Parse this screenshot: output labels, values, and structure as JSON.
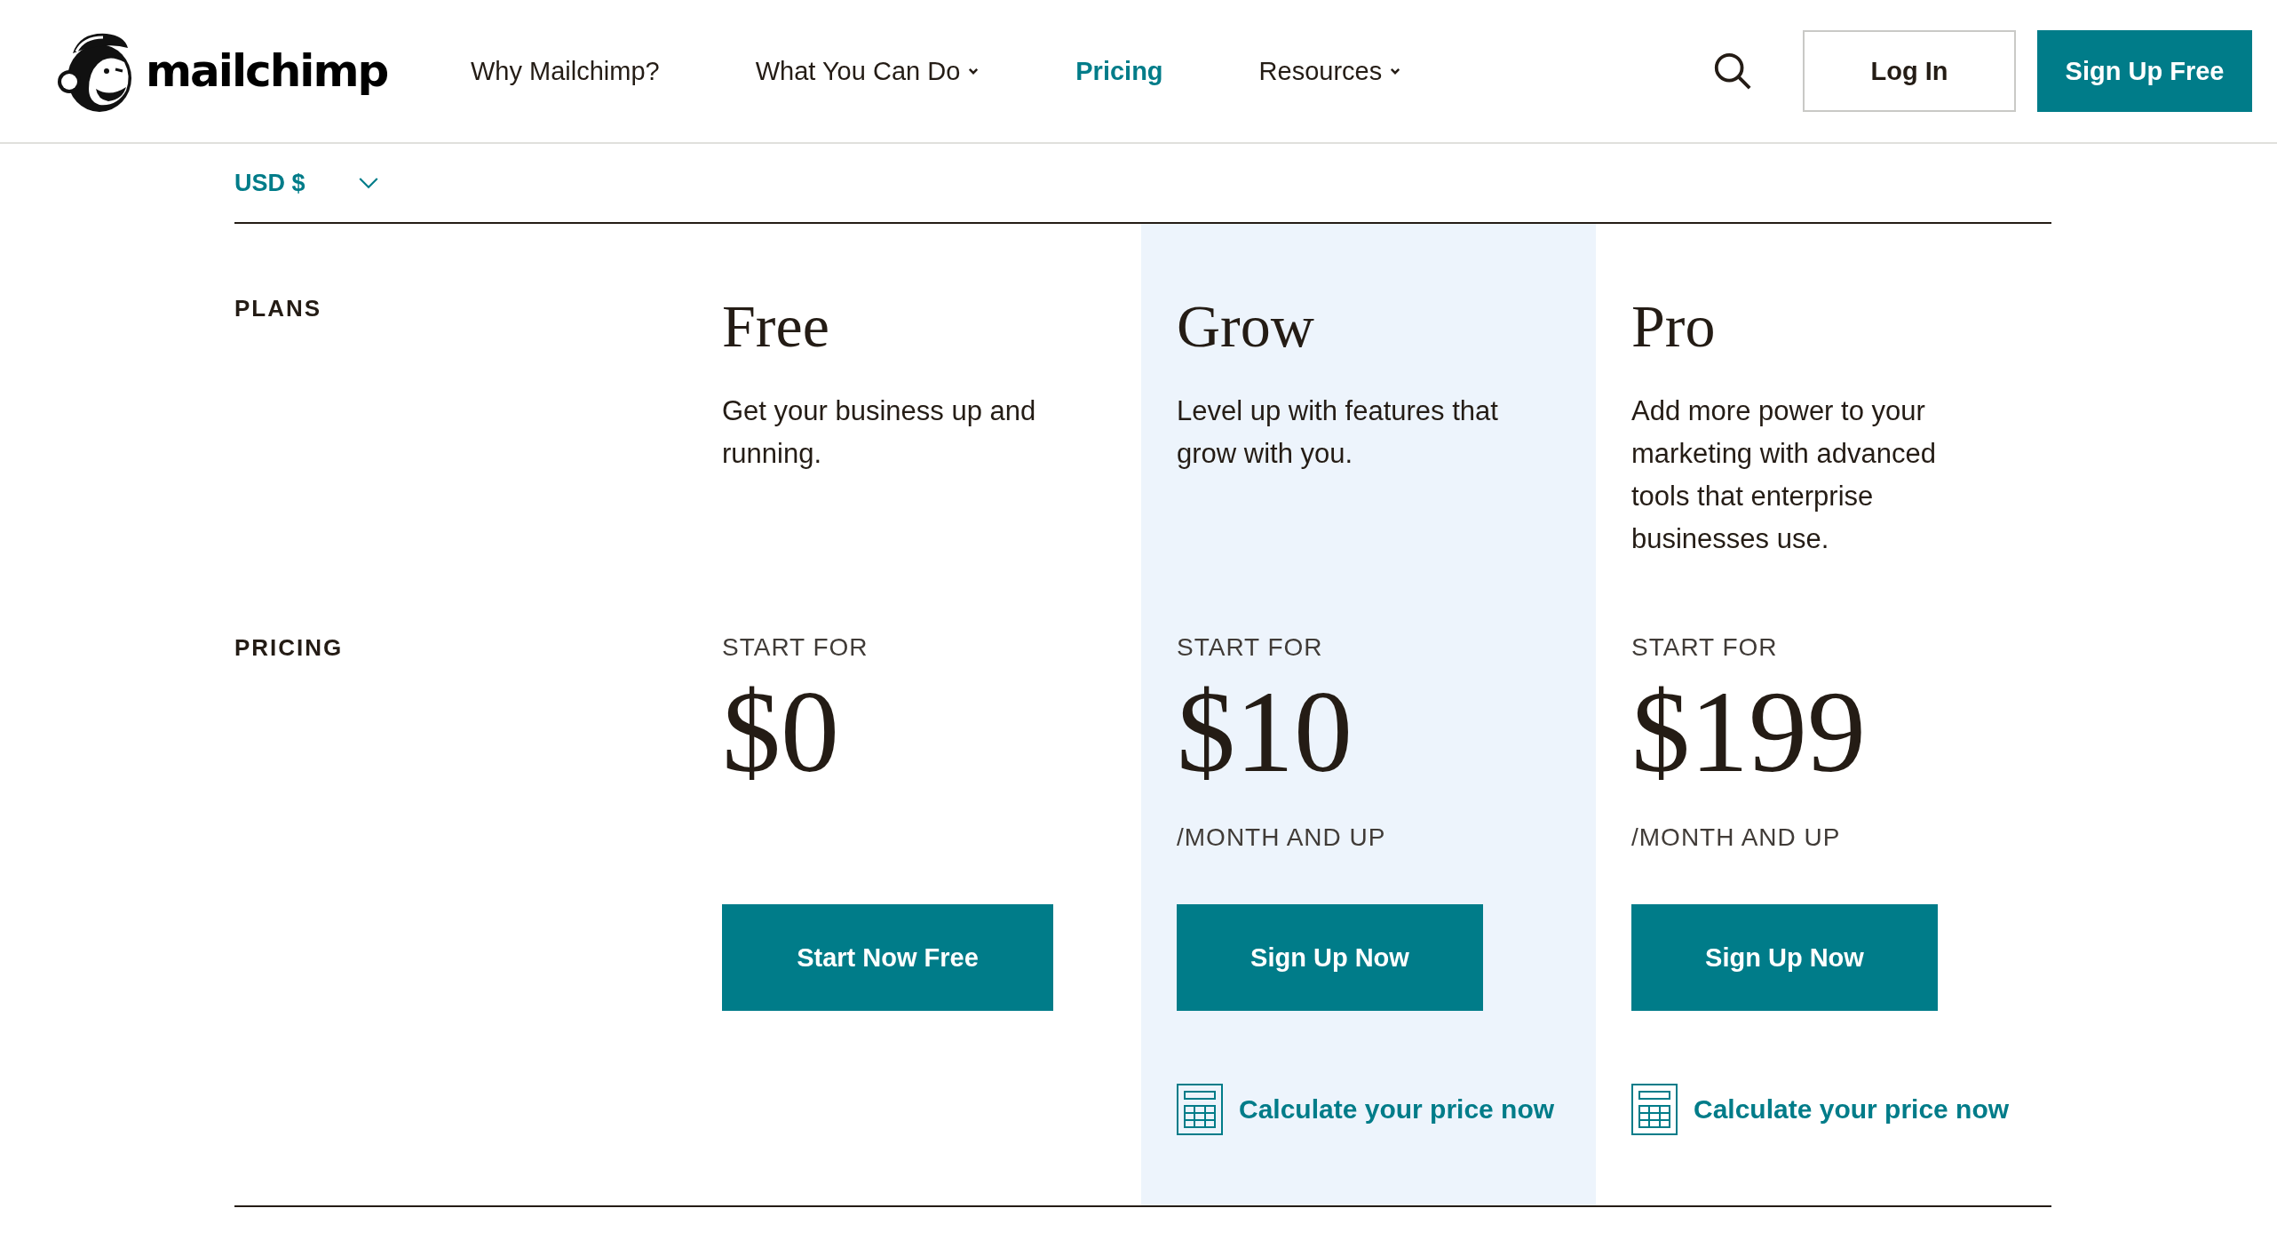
{
  "header": {
    "logo_text": "mailchimp",
    "nav": [
      {
        "label": "Why Mailchimp?",
        "selected": false,
        "has_dropdown": false
      },
      {
        "label": "What You Can Do",
        "selected": false,
        "has_dropdown": true
      },
      {
        "label": "Pricing",
        "selected": true,
        "has_dropdown": false
      },
      {
        "label": "Resources",
        "selected": false,
        "has_dropdown": true
      }
    ],
    "login": "Log In",
    "signup": "Sign Up Free"
  },
  "currency": "USD $",
  "row_labels": {
    "plans": "PLANS",
    "pricing": "PRICING"
  },
  "plans": [
    {
      "name": "Free",
      "description": "Get your business up and running.",
      "highlighted": false,
      "start_label": "START FOR",
      "price": "$0",
      "button": "Start Now Free"
    },
    {
      "name": "Grow",
      "description": "Level up with features that grow with you.",
      "highlighted": true,
      "start_label": "START FOR",
      "price": "$10",
      "per": "/MONTH AND UP",
      "button": "Sign Up Now",
      "calc_link": "Calculate your price now"
    },
    {
      "name": "Pro",
      "description": "Add more power to your marketing with advanced tools that enterprise businesses use.",
      "highlighted": false,
      "start_label": "START FOR",
      "price": "$199",
      "per": "/MONTH AND UP",
      "button": "Sign Up Now",
      "calc_link": "Calculate your price now"
    }
  ]
}
